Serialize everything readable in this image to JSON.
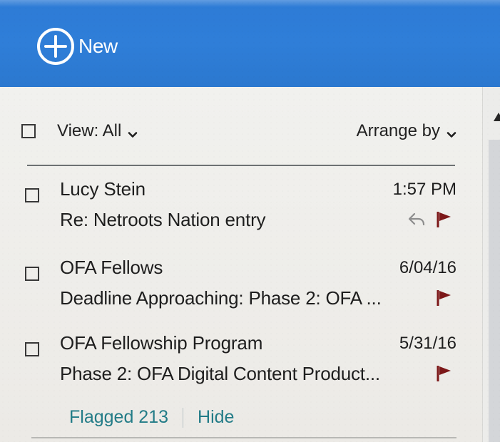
{
  "header": {
    "new_label": "New",
    "accent": "#2f7ed8",
    "icon": "plus-circle-icon"
  },
  "toolbar": {
    "view_label": "View: All",
    "arrange_label": "Arrange by"
  },
  "messages": [
    {
      "sender": "Lucy Stein",
      "time": "1:57 PM",
      "subject": "Re: Netroots Nation entry",
      "reply_icon": "reply-icon",
      "flag_icon": "flag-icon"
    },
    {
      "sender": "OFA Fellows",
      "time": "6/04/16",
      "subject": "Deadline Approaching: Phase 2: OFA ...",
      "flag_icon": "flag-icon"
    },
    {
      "sender": "OFA Fellowship Program",
      "time": "5/31/16",
      "subject": "Phase 2: OFA Digital Content Product...",
      "flag_icon": "flag-icon"
    }
  ],
  "footer": {
    "flagged_label": "Flagged 213",
    "hide_label": "Hide",
    "link_color": "#237c87",
    "flag_color": "#7c1718",
    "reply_color": "#8d8d8d"
  }
}
